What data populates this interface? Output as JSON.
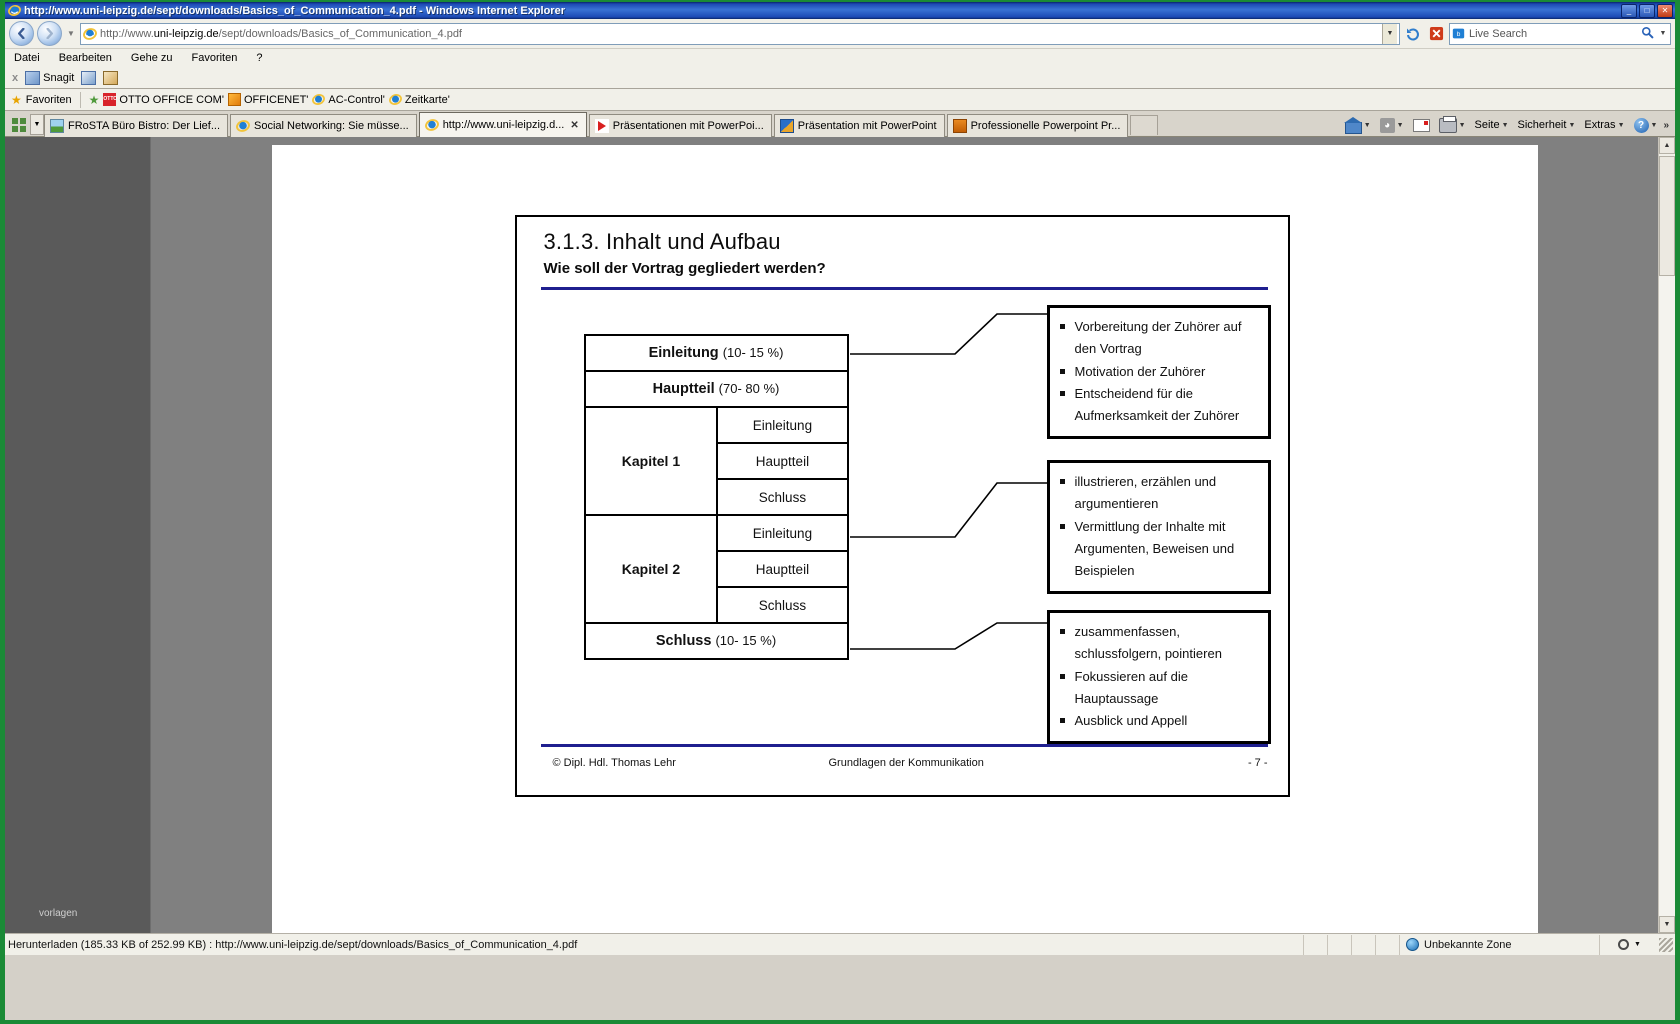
{
  "window": {
    "title": "http://www.uni-leipzig.de/sept/downloads/Basics_of_Communication_4.pdf - Windows Internet Explorer",
    "icon": "ie-logo-icon",
    "minimize": "_",
    "maximize": "□",
    "close": "✕"
  },
  "address_bar": {
    "back": "◀",
    "forward": "▶",
    "history_caret": "▼",
    "url_prefix": "http://www.",
    "url_domain": "uni-leipzig.de",
    "url_suffix": "/sept/downloads/Basics_of_Communication_4.pdf",
    "url_full": "http://www.uni-leipzig.de/sept/downloads/Basics_of_Communication_4.pdf",
    "dropdown_caret": "▼",
    "refresh_icon": "↻",
    "stop_icon": "✕",
    "search_placeholder": "Live Search",
    "search_icon": "⌕",
    "search_caret": "▼"
  },
  "menu": {
    "items": [
      "Datei",
      "Bearbeiten",
      "Gehe zu",
      "Favoriten",
      "?"
    ]
  },
  "snagit_toolbar": {
    "close_label": "x",
    "label": "Snagit",
    "icons": [
      "snagit-capture-icon",
      "snagit-profile-icon",
      "snagit-editor-icon"
    ]
  },
  "favorites_bar": {
    "label": "Favoriten",
    "items": [
      {
        "label": "OTTO OFFICE COM'",
        "icon": "otto-office-icon"
      },
      {
        "label": "OFFICENET'",
        "icon": "officenet-icon"
      },
      {
        "label": "AC-Control'",
        "icon": "ie-page-icon"
      },
      {
        "label": "Zeitkarte'",
        "icon": "ie-page-icon"
      }
    ]
  },
  "tabs": {
    "quick_tabs_icon": "quick-tabs-grid-icon",
    "tab_list_caret": "▼",
    "items": [
      {
        "label": "FRoSTA Büro Bistro: Der Lief...",
        "icon": "frosta-icon",
        "active": false
      },
      {
        "label": "Social Networking: Sie müsse...",
        "icon": "ie-page-icon",
        "active": false
      },
      {
        "label": "http://www.uni-leipzig.d...",
        "icon": "ie-page-icon",
        "active": true,
        "close": "✕"
      },
      {
        "label": "Präsentationen mit PowerPoi...",
        "icon": "powerpoint-play-icon",
        "active": false
      },
      {
        "label": "Präsentation mit PowerPoint",
        "icon": "powerpoint-multi-icon",
        "active": false
      },
      {
        "label": "Professionelle Powerpoint Pr...",
        "icon": "powerpoint-orange-icon",
        "active": false
      }
    ],
    "commands": [
      {
        "label": "",
        "icon": "home-icon",
        "caret": "▼"
      },
      {
        "label": "",
        "icon": "rss-feed-icon",
        "caret": "▼"
      },
      {
        "label": "",
        "icon": "mail-icon",
        "caret": ""
      },
      {
        "label": "",
        "icon": "print-icon",
        "caret": "▼"
      },
      {
        "label": "Seite",
        "icon": "",
        "caret": "▼"
      },
      {
        "label": "Sicherheit",
        "icon": "",
        "caret": "▼"
      },
      {
        "label": "Extras",
        "icon": "",
        "caret": "▼"
      },
      {
        "label": "",
        "icon": "help-icon",
        "caret": "▼"
      }
    ],
    "overflow": "»"
  },
  "left_pane": {
    "label": "vorlagen"
  },
  "document": {
    "title": "3.1.3. Inhalt und Aufbau",
    "subtitle": "Wie soll der Vortrag gegliedert werden?",
    "accent_color": "#1f1f8f",
    "structure": {
      "intro": {
        "name": "Einleitung",
        "percent": "(10- 15 %)"
      },
      "main": {
        "name": "Hauptteil",
        "percent": "(70- 80 %)"
      },
      "chapters": [
        {
          "name": "Kapitel 1",
          "parts": [
            "Einleitung",
            "Hauptteil",
            "Schluss"
          ]
        },
        {
          "name": "Kapitel 2",
          "parts": [
            "Einleitung",
            "Hauptteil",
            "Schluss"
          ]
        }
      ],
      "conclusion": {
        "name": "Schluss",
        "percent": "(10- 15 %)"
      }
    },
    "callouts": [
      {
        "id": "intro-callout",
        "bullets": [
          "Vorbereitung der Zuhörer auf den Vortrag",
          "Motivation der Zuhörer",
          "Entscheidend für die Aufmerksamkeit der Zuhörer"
        ]
      },
      {
        "id": "main-callout",
        "bullets": [
          "illustrieren, erzählen und argumentieren",
          "Vermittlung der Inhalte mit Argumenten, Beweisen und Beispielen"
        ]
      },
      {
        "id": "conclusion-callout",
        "bullets": [
          "zusammenfassen, schlussfolgern, pointieren",
          "Fokussieren auf die Hauptaussage",
          "Ausblick und Appell"
        ]
      }
    ],
    "footer": {
      "copyright": "© Dipl. Hdl. Thomas Lehr",
      "center": "Grundlagen der Kommunikation",
      "page": "- 7 -"
    }
  },
  "status_bar": {
    "message": "Herunterladen (185.33 KB of 252.99 KB) : http://www.uni-leipzig.de/sept/downloads/Basics_of_Communication_4.pdf",
    "zone": "Unbekannte Zone",
    "zone_icon": "globe-icon",
    "zoom_icon": "magnifier-icon",
    "zoom_caret": "▼"
  },
  "scrollbar": {
    "up": "▲",
    "down": "▼"
  }
}
